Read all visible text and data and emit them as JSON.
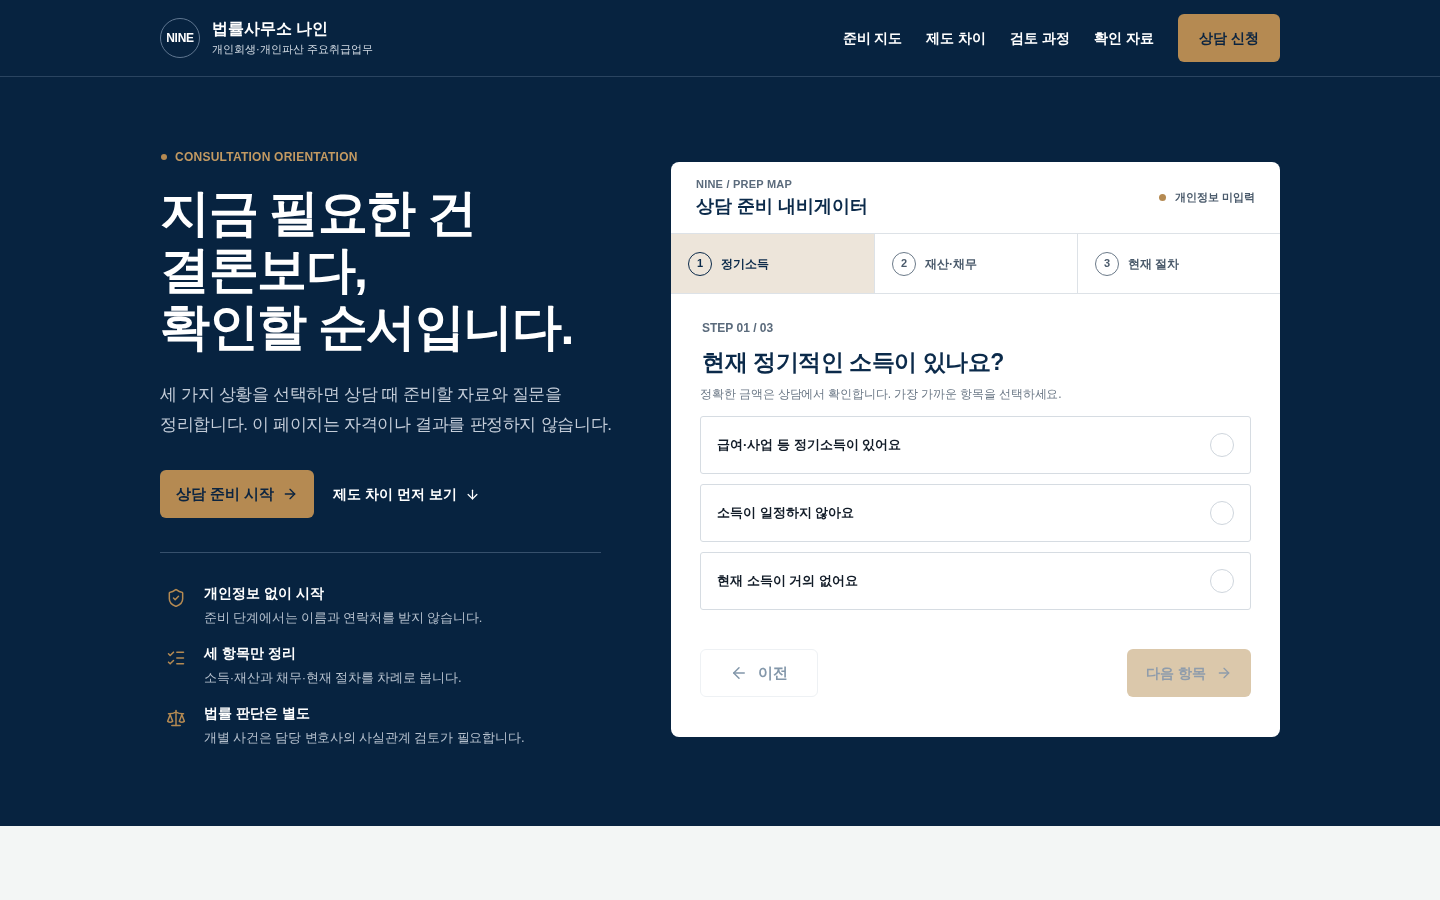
{
  "header": {
    "logo_mark": "NINE",
    "brand_name": "법률사무소 나인",
    "brand_tagline": "개인회생·개인파산 주요취급업무",
    "nav": [
      {
        "label": "준비 지도"
      },
      {
        "label": "제도 차이"
      },
      {
        "label": "검토 과정"
      },
      {
        "label": "확인 자료"
      }
    ],
    "cta": "상담 신청"
  },
  "hero": {
    "eyebrow": "CONSULTATION ORIENTATION",
    "headline_lines": [
      "지금 필요한 건",
      "결론보다,",
      "확인할 순서입니다."
    ],
    "description_lines": [
      "세 가지 상황을 선택하면 상담 때 준비할 자료와 질문을",
      "정리합니다. 이 페이지는 자격이나 결과를 판정하지 않습니다."
    ],
    "primary_button": "상담 준비 시작",
    "secondary_link": "제도 차이 먼저 보기",
    "features": [
      {
        "kind": "shield",
        "title": "개인정보 없이 시작",
        "description": "준비 단계에서는 이름과 연락처를 받지 않습니다."
      },
      {
        "kind": "checklist",
        "title": "세 항목만 정리",
        "description": "소득·재산과 채무·현재 절차를 차례로 봅니다."
      },
      {
        "kind": "scale",
        "title": "법률 판단은 별도",
        "description": "개별 사건은 담당 변호사의 사실관계 검토가 필요합니다."
      }
    ]
  },
  "navigator": {
    "eyebrow": "NINE / PREP MAP",
    "title": "상담 준비 내비게이터",
    "status": {
      "label": "개인정보 미입력",
      "color": "#b58a52"
    },
    "steps": [
      {
        "number": "1",
        "label": "정기소득",
        "selected": true
      },
      {
        "number": "2",
        "label": "재산·채무",
        "selected": false
      },
      {
        "number": "3",
        "label": "현재 절차",
        "selected": false
      }
    ],
    "step_counter": "STEP 01 / 03",
    "question": "현재 정기적인 소득이 있나요?",
    "hint": "정확한 금액은 상담에서 확인합니다. 가장 가까운 항목을 선택하세요.",
    "options": [
      {
        "label": "급여·사업 등 정기소득이 있어요",
        "selected": false
      },
      {
        "label": "소득이 일정하지 않아요",
        "selected": false
      },
      {
        "label": "현재 소득이 거의 없어요",
        "selected": false
      }
    ],
    "prev_button": {
      "label": "이전",
      "disabled": true
    },
    "next_button": {
      "label": "다음 항목",
      "disabled": true
    }
  }
}
